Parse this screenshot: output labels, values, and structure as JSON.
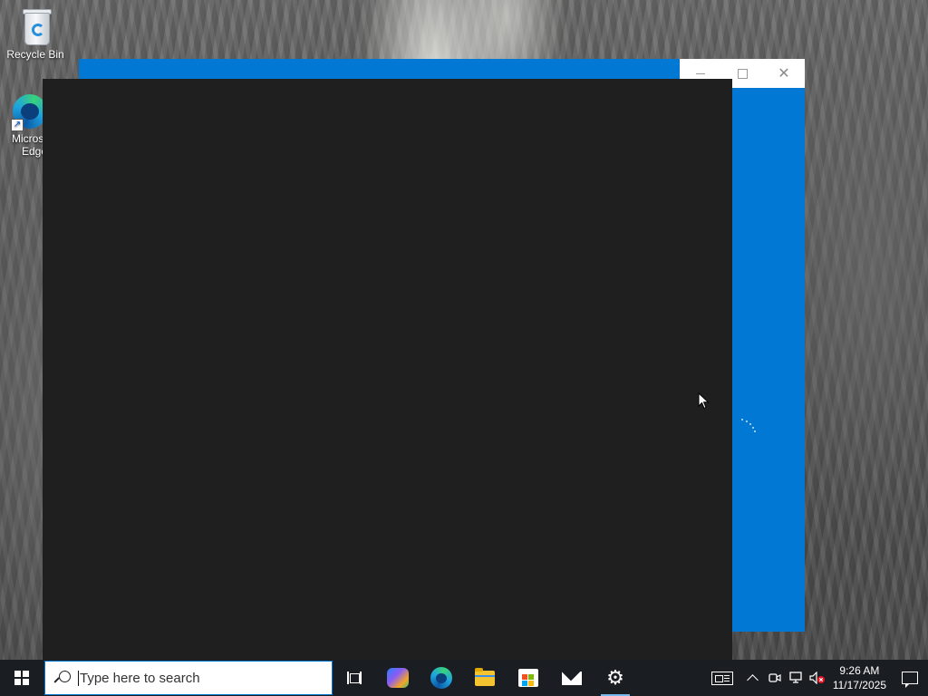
{
  "desktop": {
    "icons": [
      {
        "label": "Recycle Bin",
        "icon": "recycle-bin-icon"
      },
      {
        "label_line1": "Micros",
        "label_line2": "Edge",
        "icon": "microsoft-edge-icon"
      }
    ]
  },
  "background_window": {
    "accent_color": "#0078d4",
    "caption_buttons": [
      "minimize",
      "maximize",
      "close"
    ]
  },
  "foreground_window": {
    "background_color": "#1f1f1f"
  },
  "taskbar": {
    "search": {
      "placeholder": "Type here to search"
    },
    "pinned_apps": [
      {
        "name": "Task View",
        "icon": "task-view-icon"
      },
      {
        "name": "Copilot",
        "icon": "copilot-icon"
      },
      {
        "name": "Microsoft Edge",
        "icon": "edge-icon"
      },
      {
        "name": "File Explorer",
        "icon": "folder-icon"
      },
      {
        "name": "Microsoft Store",
        "icon": "store-icon"
      },
      {
        "name": "Mail",
        "icon": "mail-icon"
      },
      {
        "name": "Settings",
        "icon": "gear-icon",
        "active": true
      }
    ],
    "tray": {
      "time": "9:26 AM",
      "date": "11/17/2025",
      "icons": [
        "news-icon",
        "chevron-up-icon",
        "meet-icon",
        "network-icon",
        "volume-muted-icon",
        "notification-icon"
      ]
    }
  }
}
